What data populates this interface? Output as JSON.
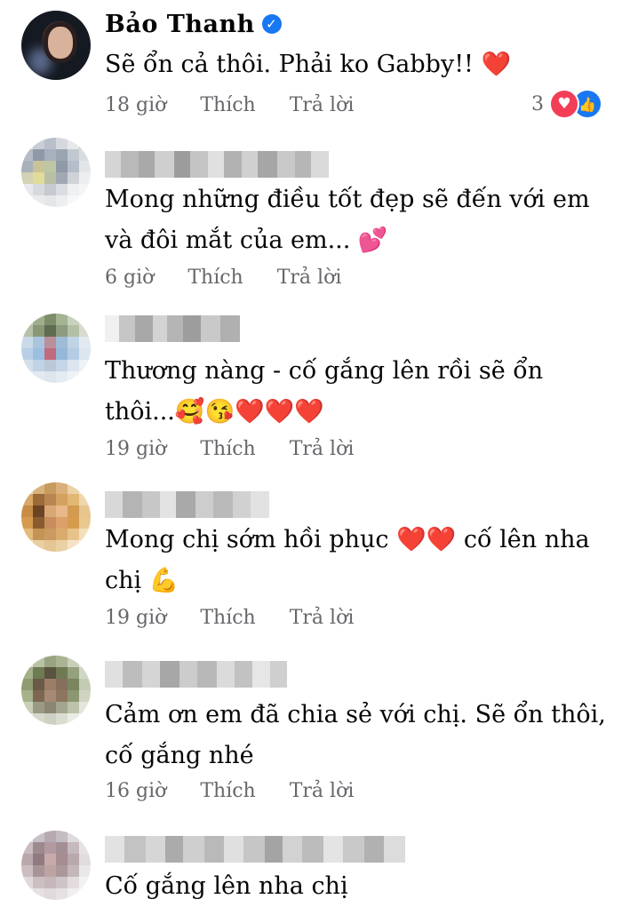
{
  "comments": [
    {
      "author": "Bảo Thanh",
      "verified": true,
      "text_lines": [
        "Sẽ ổn cả thôi. Phải ko Gabby!! ❤️"
      ],
      "time": "18 giờ",
      "like_label": "Thích",
      "reply_label": "Trả lời",
      "reaction_count": "3",
      "reactions": [
        "heart-icon",
        "like-icon"
      ]
    },
    {
      "author": "",
      "text_lines": [
        "Mong những điều tốt đẹp sẽ đến với em",
        "và đôi mắt của em... 💕"
      ],
      "time": "6 giờ",
      "like_label": "Thích",
      "reply_label": "Trả lời"
    },
    {
      "author": "",
      "text_lines": [
        "Thương nàng - cố gắng lên rồi sẽ ổn",
        "thôi...🥰😘❤️❤️❤️"
      ],
      "time": "19 giờ",
      "like_label": "Thích",
      "reply_label": "Trả lời"
    },
    {
      "author": "",
      "text_lines": [
        "Mong chị sớm hồi phục ❤️❤️ cố lên nha",
        "chị 💪"
      ],
      "time": "19 giờ",
      "like_label": "Thích",
      "reply_label": "Trả lời"
    },
    {
      "author": "",
      "text_lines": [
        "Cảm ơn em đã chia sẻ với chị. Sẽ ổn thôi,",
        "cố gắng nhé"
      ],
      "time": "16 giờ",
      "like_label": "Thích",
      "reply_label": "Trả lời"
    },
    {
      "author": "",
      "text_lines": [
        "Cố gắng lên nha chị"
      ]
    }
  ],
  "colors": {
    "accent": "#1877f2",
    "heart": "#f33e58",
    "meta_text": "#65676b"
  }
}
